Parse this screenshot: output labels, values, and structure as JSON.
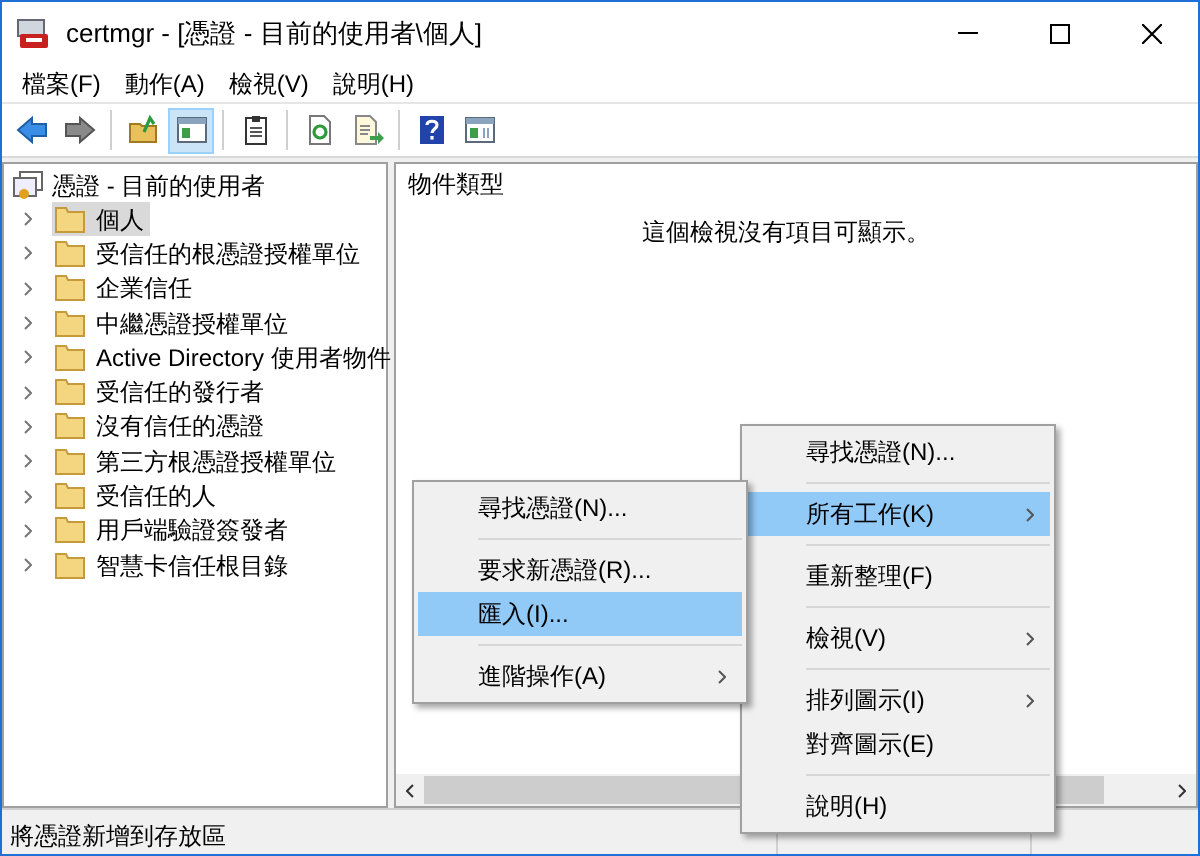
{
  "window": {
    "title": "certmgr - [憑證 - 目前的使用者\\個人]"
  },
  "menu_bar": [
    "檔案(F)",
    "動作(A)",
    "檢視(V)",
    "說明(H)"
  ],
  "toolbar": [
    {
      "kind": "back",
      "selected": false
    },
    {
      "kind": "forward",
      "selected": false
    },
    {
      "kind": "sep"
    },
    {
      "kind": "up",
      "selected": false
    },
    {
      "kind": "tree",
      "selected": true
    },
    {
      "kind": "sep"
    },
    {
      "kind": "clipboard",
      "selected": false
    },
    {
      "kind": "sep"
    },
    {
      "kind": "refresh",
      "selected": false
    },
    {
      "kind": "export",
      "selected": false
    },
    {
      "kind": "sep"
    },
    {
      "kind": "help",
      "selected": false
    },
    {
      "kind": "pane",
      "selected": false
    }
  ],
  "tree": {
    "label": "憑證 - 目前的使用者",
    "children": [
      {
        "label": "個人",
        "selected": true
      },
      {
        "label": "受信任的根憑證授權單位",
        "selected": false
      },
      {
        "label": "企業信任",
        "selected": false
      },
      {
        "label": "中繼憑證授權單位",
        "selected": false
      },
      {
        "label": "Active Directory 使用者物件",
        "selected": false
      },
      {
        "label": "受信任的發行者",
        "selected": false
      },
      {
        "label": "沒有信任的憑證",
        "selected": false
      },
      {
        "label": "第三方根憑證授權單位",
        "selected": false
      },
      {
        "label": "受信任的人",
        "selected": false
      },
      {
        "label": "用戶端驗證簽發者",
        "selected": false
      },
      {
        "label": "智慧卡信任根目錄",
        "selected": false
      }
    ]
  },
  "list_view": {
    "column_header": "物件類型",
    "empty_message": "這個檢視沒有項目可顯示。"
  },
  "context_menu": [
    {
      "kind": "item",
      "label": "尋找憑證(N)...",
      "submenu": false,
      "selected": false
    },
    {
      "kind": "separator"
    },
    {
      "kind": "item",
      "label": "所有工作(K)",
      "submenu": true,
      "selected": true
    },
    {
      "kind": "separator"
    },
    {
      "kind": "item",
      "label": "重新整理(F)",
      "submenu": false,
      "selected": false
    },
    {
      "kind": "separator"
    },
    {
      "kind": "item",
      "label": "檢視(V)",
      "submenu": true,
      "selected": false
    },
    {
      "kind": "separator"
    },
    {
      "kind": "item",
      "label": "排列圖示(I)",
      "submenu": true,
      "selected": false
    },
    {
      "kind": "item",
      "label": "對齊圖示(E)",
      "submenu": false,
      "selected": false
    },
    {
      "kind": "separator"
    },
    {
      "kind": "item",
      "label": "說明(H)",
      "submenu": false,
      "selected": false
    }
  ],
  "submenu": [
    {
      "kind": "item",
      "label": "尋找憑證(N)...",
      "submenu": false,
      "selected": false
    },
    {
      "kind": "separator"
    },
    {
      "kind": "item",
      "label": "要求新憑證(R)...",
      "submenu": false,
      "selected": false
    },
    {
      "kind": "item",
      "label": "匯入(I)...",
      "submenu": false,
      "selected": true
    },
    {
      "kind": "separator"
    },
    {
      "kind": "item",
      "label": "進階操作(A)",
      "submenu": true,
      "selected": false
    }
  ],
  "status_bar": "將憑證新增到存放區"
}
